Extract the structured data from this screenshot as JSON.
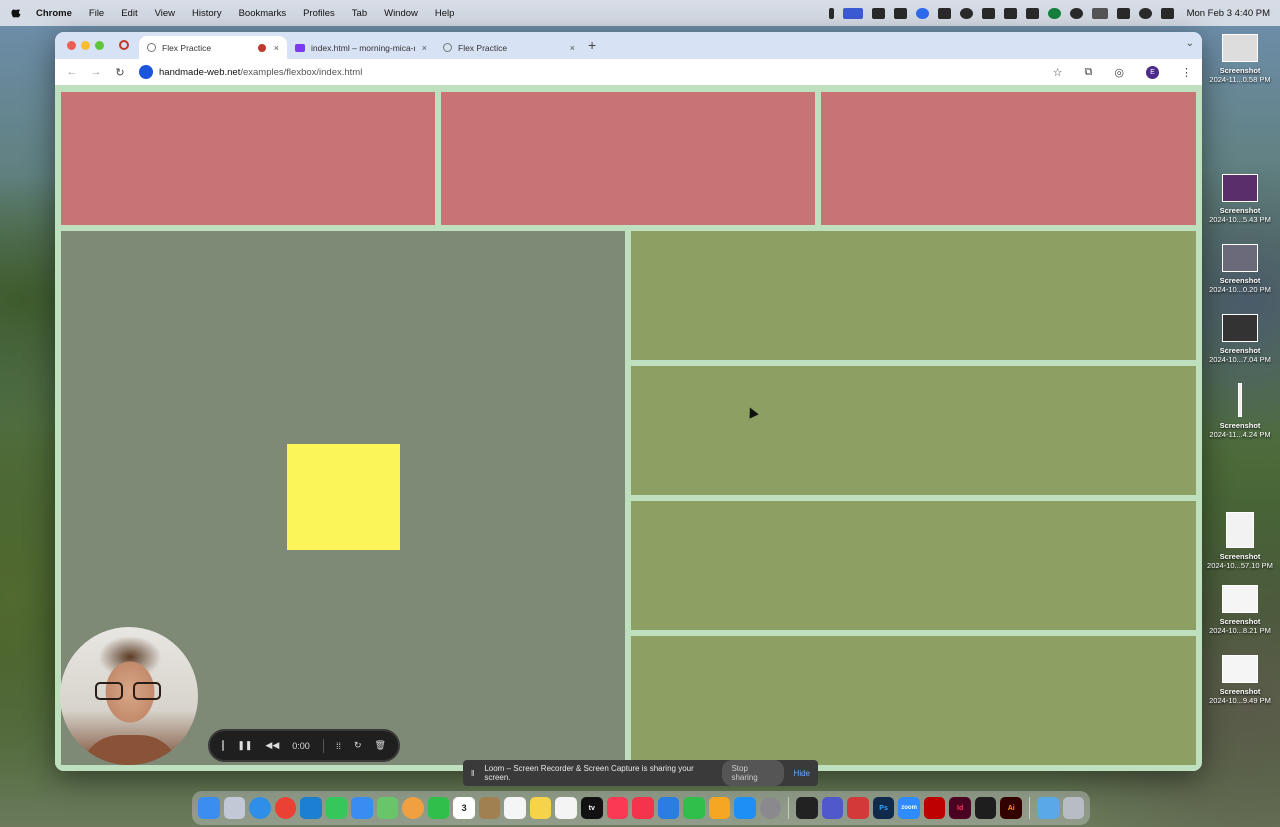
{
  "menubar": {
    "items": [
      "Chrome",
      "File",
      "Edit",
      "View",
      "History",
      "Bookmarks",
      "Profiles",
      "Tab",
      "Window",
      "Help"
    ],
    "clock": "Mon Feb 3  4:40 PM"
  },
  "tabs": [
    {
      "title": "Flex Practice",
      "icon": "globe-icon",
      "active": true,
      "close": "×"
    },
    {
      "title": "index.html – morning-mica-n",
      "icon": "vite-icon",
      "active": false,
      "close": "×"
    },
    {
      "title": "Flex Practice",
      "icon": "globe-icon",
      "active": false,
      "close": "×"
    }
  ],
  "toolbar": {
    "back": "←",
    "forward": "→",
    "reload": "↻",
    "url_host": "handmade-web.net",
    "url_path": "/examples/flexbox/index.html",
    "profile_initial": "E",
    "bookmark": "☆",
    "extensions": "⧉",
    "more": "⋮",
    "new_tab": "+",
    "tab_menu": "⌄"
  },
  "page": {
    "colors": {
      "red": "#c97474",
      "gray": "#7f8a76",
      "green": "#8ba062",
      "yellow": "#fbf55a",
      "background": "#bfe0be"
    }
  },
  "loom": {
    "timer": "0:00",
    "share_message": "Loom – Screen Recorder & Screen Capture is sharing your screen.",
    "stop_sharing": "Stop sharing",
    "hide": "Hide"
  },
  "desktop": {
    "files": [
      {
        "name": "Screenshot",
        "date": "2024-11...0.58 PM"
      },
      {
        "name": "Screenshot",
        "date": "2024-10...5.43 PM"
      },
      {
        "name": "Screenshot",
        "date": "2024-10...0.20 PM"
      },
      {
        "name": "Screenshot",
        "date": "2024-10...7.04 PM"
      },
      {
        "name": "Screenshot",
        "date": "2024-11...4.24 PM"
      },
      {
        "name": "Screenshot",
        "date": "2024-10...57.10 PM"
      },
      {
        "name": "Screenshot",
        "date": "2024-10...8.21 PM"
      },
      {
        "name": "Screenshot",
        "date": "2024-10...9.49 PM"
      }
    ]
  },
  "dock": {
    "apps": [
      "finder-icon",
      "launchpad-icon",
      "safari-icon",
      "chrome-icon",
      "vscode-icon",
      "messages-icon",
      "mail-icon",
      "maps-icon",
      "photos-icon",
      "facetime-icon",
      "calendar-icon",
      "notes-icon",
      "reminders-icon",
      "stickies-icon",
      "freeform-icon",
      "appletv-icon",
      "music-icon",
      "news-icon",
      "keynote-icon",
      "numbers-icon",
      "pages-icon",
      "appstore-icon",
      "settings-icon",
      "terminal-icon",
      "teams-icon",
      "scrivener-icon",
      "photoshop-icon",
      "zoom-icon",
      "filezilla-icon",
      "indesign-icon",
      "figma-icon",
      "illustrator-icon",
      "folder-icon",
      "trash-icon"
    ],
    "calendar_day": "3",
    "labels": {
      "photoshop": "Ps",
      "indesign": "Id",
      "illustrator": "Ai",
      "zoom": "zoom",
      "appletv": "tv"
    }
  }
}
